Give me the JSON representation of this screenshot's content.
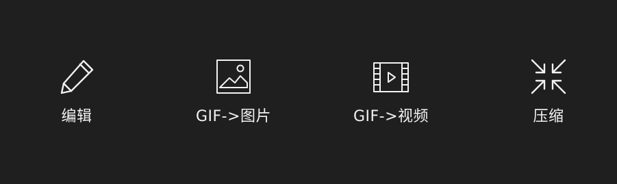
{
  "toolbar": {
    "items": [
      {
        "icon": "pencil-icon",
        "label": "编辑"
      },
      {
        "icon": "image-icon",
        "label": "GIF->图片"
      },
      {
        "icon": "video-icon",
        "label": "GIF->视频"
      },
      {
        "icon": "compress-icon",
        "label": "压缩"
      }
    ]
  },
  "colors": {
    "background": "#1f1f1f",
    "foreground": "#f2f2f2"
  }
}
